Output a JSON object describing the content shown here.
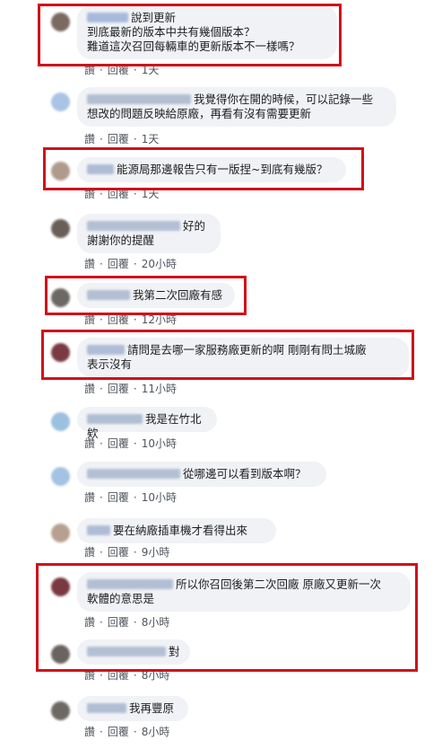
{
  "actions": {
    "like": "讚",
    "reply": "回覆",
    "sep": "·"
  },
  "comments": [
    {
      "line1": "說到更新",
      "line2": "到底最新的版本中共有幾個版本？",
      "line3": "難道這次召回每輛車的更新版本不一樣嗎？",
      "time": "1天"
    },
    {
      "line1": "我覺得你在開的時候，可以記錄一些",
      "line2": "想改的問題反映給原廠，再看有沒有需要更新",
      "time": "1天"
    },
    {
      "line1": "能源局那邊報告只有一版捏~到底有幾版？",
      "time": "1天"
    },
    {
      "line1": "好的",
      "line2": "謝謝你的提醒",
      "time": "20小時"
    },
    {
      "line1": "我第二次回廠有感",
      "time": "12小時"
    },
    {
      "line1": "請問是去哪一家服務廠更新的啊 剛剛有問土城廠",
      "line2": "表示沒有",
      "time": "11小時"
    },
    {
      "line1": "我是在竹北欸",
      "time": "10小時"
    },
    {
      "line1": "從哪邊可以看到版本啊？",
      "time": "10小時"
    },
    {
      "line1": "要在納廠插車機才看得出來",
      "time": "9小時"
    },
    {
      "line1": "所以你召回後第二次回廠 原廠又更新一次",
      "line2": "軟體的意思是",
      "time": "8小時"
    },
    {
      "line1": "對",
      "time": "8小時"
    },
    {
      "line1": "我再豐原",
      "time": "8小時"
    }
  ],
  "colors": {
    "highlight": "#d0121b",
    "bubble": "#f0f2f5",
    "meta": "#50555c"
  }
}
